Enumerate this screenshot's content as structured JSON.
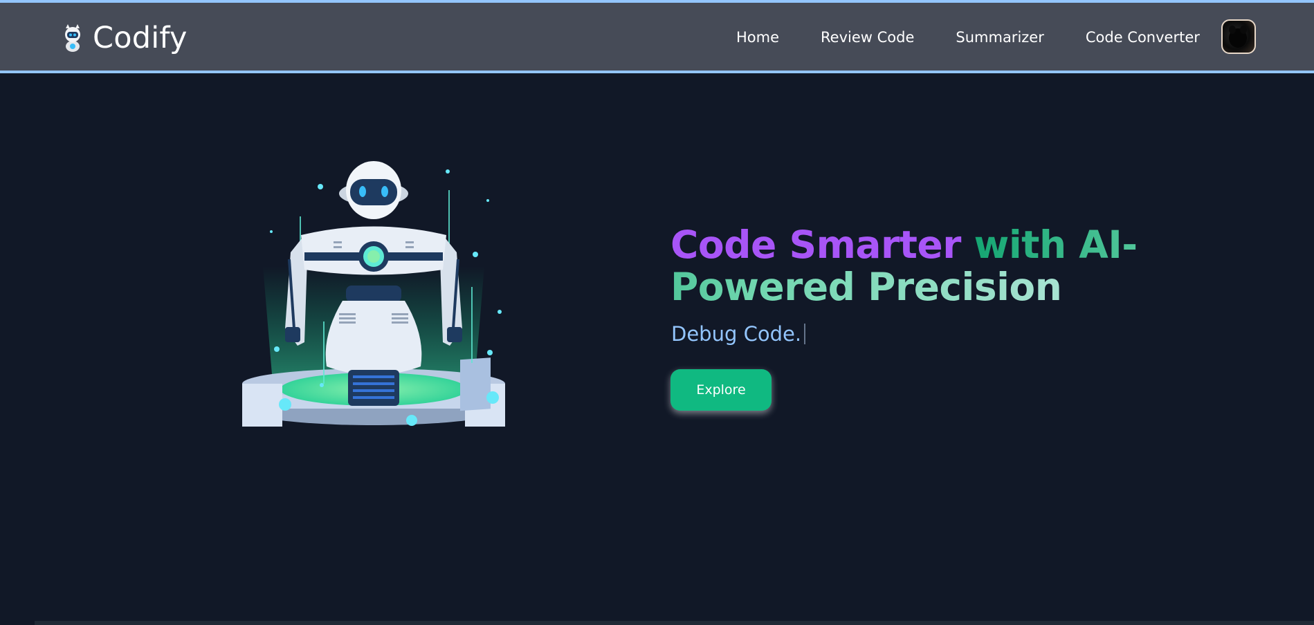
{
  "brand": {
    "name": "Codify",
    "logo_icon": "robot-icon"
  },
  "nav": {
    "home": "Home",
    "review_code": "Review Code",
    "summarizer": "Summarizer",
    "code_converter": "Code Converter"
  },
  "avatar": {
    "icon": "user-avatar"
  },
  "hero": {
    "headline_accent": "Code Smarter",
    "headline_rest": " with AI-Powered Precision",
    "typewriter_text": "Debug Code.",
    "explore_label": "Explore",
    "illustration": "robot-illustration"
  },
  "colors": {
    "background": "#111827",
    "navbar": "#464b57",
    "navbar_border": "#93c5fd",
    "accent_purple": "#a855f7",
    "accent_green": "#10b981",
    "typewriter_blue": "#93c5fd"
  }
}
